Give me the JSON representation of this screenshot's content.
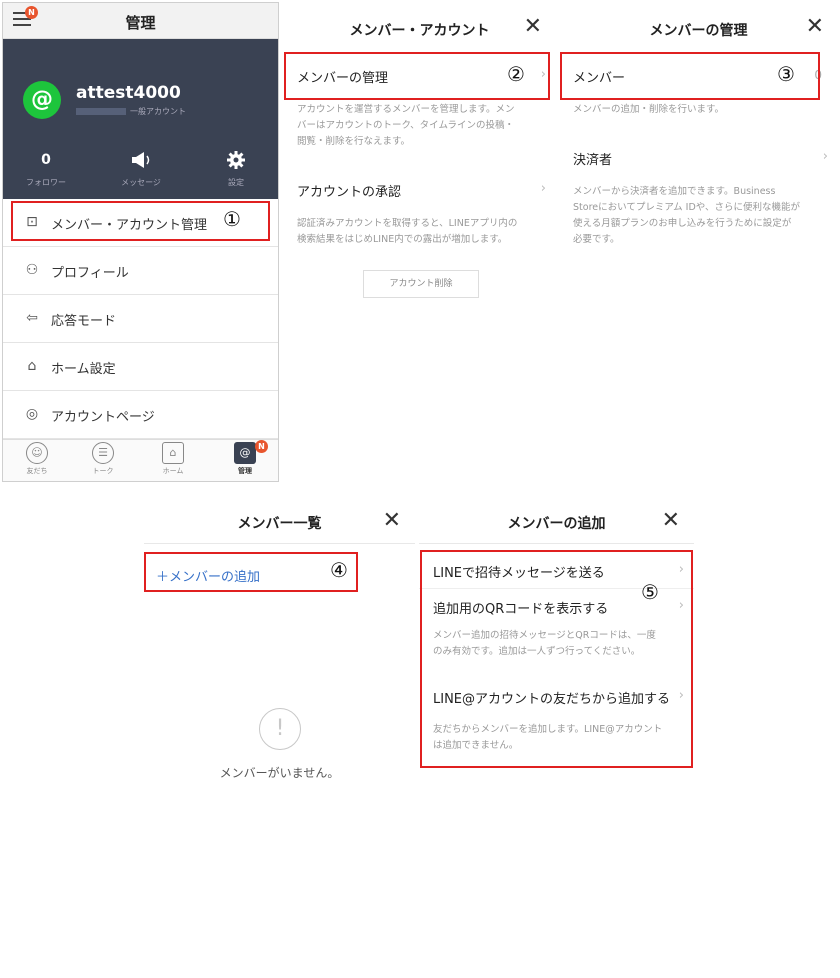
{
  "panel1": {
    "title": "管理",
    "hamburger_badge": "N",
    "account": {
      "avatar_symbol": "@",
      "name": "attest4000",
      "type": "一般アカウント"
    },
    "stats": [
      {
        "value": "0",
        "label": "フォロワー"
      },
      {
        "label": "メッセージ"
      },
      {
        "label": "設定"
      }
    ],
    "menu": [
      {
        "label": "メンバー・アカウント管理",
        "icon": "account-card-icon",
        "glyph": "⊡"
      },
      {
        "label": "プロフィール",
        "icon": "profile-icon",
        "glyph": "⚇"
      },
      {
        "label": "応答モード",
        "icon": "reply-mode-icon",
        "glyph": "⇦"
      },
      {
        "label": "ホーム設定",
        "icon": "home-settings-icon",
        "glyph": "⌂"
      },
      {
        "label": "アカウントページ",
        "icon": "account-page-icon",
        "glyph": "◎"
      }
    ],
    "tabs": [
      {
        "label": "友だち",
        "icon": "friends-icon",
        "glyph": "☺"
      },
      {
        "label": "トーク",
        "icon": "talk-icon",
        "glyph": "☰"
      },
      {
        "label": "ホーム",
        "icon": "home-icon",
        "glyph": "⌂"
      },
      {
        "label": "管理",
        "icon": "manage-icon",
        "glyph": "@"
      }
    ],
    "manage_badge": "N",
    "annotation": "①"
  },
  "panel2": {
    "title": "メンバー・アカウント",
    "close": "✕",
    "rows": [
      {
        "label": "メンバーの管理",
        "desc": [
          "アカウントを運営するメンバーを管理します。メン",
          "バーはアカウントのトーク、タイムラインの投稿・",
          "閲覧・削除を行なえます。"
        ]
      },
      {
        "label": "アカウントの承認",
        "desc": [
          "認証済みアカウントを取得すると、LINEアプリ内の",
          "検索結果をはじめLINE内での露出が増加します。"
        ]
      }
    ],
    "delete_button": "アカウント削除",
    "annotation": "②"
  },
  "panel3": {
    "title": "メンバーの管理",
    "close": "✕",
    "rows": [
      {
        "label": "メンバー",
        "count": "0",
        "desc": [
          "メンバーの追加・削除を行います。"
        ]
      },
      {
        "label": "決済者",
        "desc": [
          "メンバーから決済者を追加できます。Business",
          "Storeにおいてプレミアム IDや、さらに便利な機能が",
          "使える月額プランのお申し込みを行うために設定が",
          "必要です。"
        ]
      }
    ],
    "annotation": "③"
  },
  "panel4": {
    "title": "メンバー一覧",
    "close": "✕",
    "add_link": "＋メンバーの追加",
    "empty_icon": "!",
    "empty_text": "メンバーがいません。",
    "annotation": "④"
  },
  "panel5": {
    "title": "メンバーの追加",
    "close": "✕",
    "rows": [
      {
        "label": "LINEで招待メッセージを送る"
      },
      {
        "label": "追加用のQRコードを表示する"
      },
      {
        "label": "LINE@アカウントの友だちから追加する"
      }
    ],
    "desc1": [
      "メンバー追加の招待メッセージとQRコードは、一度",
      "のみ有効です。追加は一人ずつ行ってください。"
    ],
    "desc2": [
      "友だちからメンバーを追加します。LINE@アカウント",
      "は追加できません。"
    ],
    "annotation": "⑤"
  },
  "colors": {
    "line_green": "#1dc53c",
    "header_dark": "#3a4253",
    "highlight_red": "#e02020",
    "link_blue": "#3670c8",
    "badge_orange": "#e8552e"
  }
}
